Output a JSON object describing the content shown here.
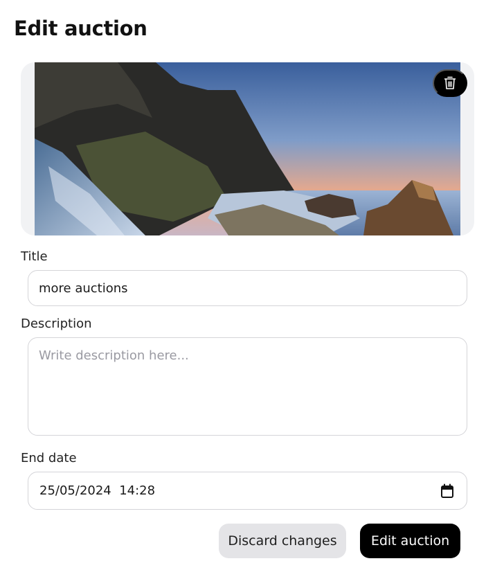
{
  "page": {
    "title": "Edit auction"
  },
  "image": {
    "delete_icon": "trash-icon"
  },
  "form": {
    "title_label": "Title",
    "title_value": "more auctions",
    "description_label": "Description",
    "description_value": "",
    "description_placeholder": "Write description here...",
    "end_date_label": "End date",
    "end_date_value": "25/05/2024  14:28",
    "calendar_icon": "calendar-icon"
  },
  "actions": {
    "discard_label": "Discard changes",
    "submit_label": "Edit auction"
  },
  "colors": {
    "primary_button_bg": "#000000",
    "secondary_button_bg": "#e4e4e7",
    "input_border": "#d4d4d8",
    "image_frame_bg": "#f1f2f4"
  }
}
